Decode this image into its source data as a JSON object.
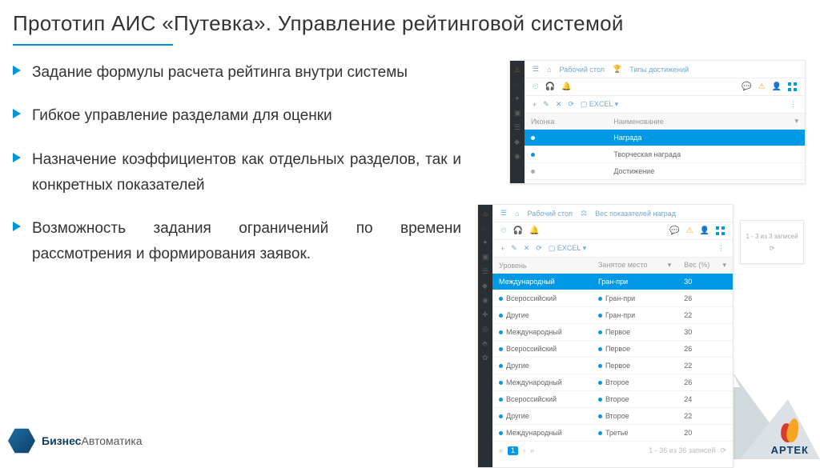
{
  "title": "Прототип АИС «Путевка». Управление рейтинговой системой",
  "bullets": [
    "Задание формулы расчета рейтинга внутри системы",
    "Гибкое управление разделами для оценки",
    "Назначение коэффициентов как отдельных разделов, так и конкретных показателей",
    "Возможность задания ограничений по времени рассмотрения и формирования заявок."
  ],
  "panel1": {
    "breadcrumb1": "Рабочий стол",
    "breadcrumb2": "Типы достижений",
    "excel": "EXCEL",
    "headers": {
      "c1": "Иконка",
      "c2": "Наименование"
    },
    "rows": [
      {
        "name": "Награда",
        "hi": true
      },
      {
        "name": "Творческая награда",
        "hi": false
      },
      {
        "name": "Достижение",
        "hi": false
      }
    ]
  },
  "panel2": {
    "breadcrumb1": "Рабочий стол",
    "breadcrumb2": "Вес показателей наград",
    "excel": "EXCEL",
    "headers": {
      "c1": "Уровень",
      "c2": "Занятое место",
      "c3": "Вес (%)"
    },
    "rows": [
      {
        "lvl": "Международный",
        "place": "Гран-при",
        "w": "30",
        "hi": true
      },
      {
        "lvl": "Всероссийский",
        "place": "Гран-при",
        "w": "26",
        "hi": false
      },
      {
        "lvl": "Другие",
        "place": "Гран-при",
        "w": "22",
        "hi": false
      },
      {
        "lvl": "Международный",
        "place": "Первое",
        "w": "30",
        "hi": false
      },
      {
        "lvl": "Всероссийский",
        "place": "Первое",
        "w": "26",
        "hi": false
      },
      {
        "lvl": "Другие",
        "place": "Первое",
        "w": "22",
        "hi": false
      },
      {
        "lvl": "Международный",
        "place": "Второе",
        "w": "26",
        "hi": false
      },
      {
        "lvl": "Всероссийский",
        "place": "Второе",
        "w": "24",
        "hi": false
      },
      {
        "lvl": "Другие",
        "place": "Второе",
        "w": "22",
        "hi": false
      },
      {
        "lvl": "Международный",
        "place": "Третье",
        "w": "20",
        "hi": false
      }
    ],
    "page_info": "1 - 36 из 36 записей"
  },
  "status": {
    "line1": "1 - 3 из 3 записей",
    "refresh": "⟳"
  },
  "footer": {
    "brand1": "Бизнес",
    "brand2": "Автоматика"
  },
  "artek": "АРТЕК"
}
